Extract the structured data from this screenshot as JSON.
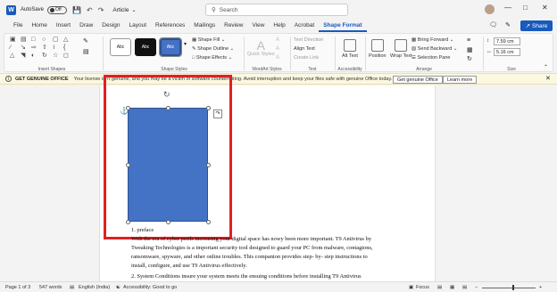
{
  "titlebar": {
    "app_logo": "W",
    "autosave_label": "AutoSave",
    "autosave_state": "Off",
    "doc_title": "Article",
    "search_placeholder": "Search",
    "icons": [
      "word-icon",
      "save-icon",
      "undo-icon",
      "redo-icon",
      "search-icon",
      "avatar",
      "minimize-icon",
      "maximize-icon",
      "close-icon"
    ]
  },
  "tabs": [
    "File",
    "Home",
    "Insert",
    "Draw",
    "Design",
    "Layout",
    "References",
    "Mailings",
    "Review",
    "View",
    "Help",
    "Acrobat",
    "Shape Format"
  ],
  "active_tab": "Shape Format",
  "share_label": "Share",
  "ribbon": {
    "insert_shapes_label": "Insert Shapes",
    "shape_styles": {
      "label": "Shape Styles",
      "swatch_text": "Abc",
      "items": [
        "Shape Fill",
        "Shape Outline",
        "Shape Effects"
      ]
    },
    "wordart": {
      "label": "WordArt Styles",
      "quick_styles": "Quick Styles"
    },
    "text": {
      "label": "Text",
      "items": [
        "Text Direction",
        "Align Text",
        "Create Link"
      ]
    },
    "accessibility": {
      "label": "Accessibility",
      "alt_text": "Alt Text"
    },
    "arrange": {
      "label": "Arrange",
      "position": "Position",
      "wrap_text": "Wrap Text",
      "items": [
        "Bring Forward",
        "Send Backward",
        "Selection Pane"
      ]
    },
    "size": {
      "label": "Size",
      "height": "7.59 cm",
      "width": "5.16 cm"
    }
  },
  "banner": {
    "title": "GET GENUINE OFFICE",
    "message": "Your license isn't genuine, and you may be a victim of software counterfeiting. Avoid interruption and keep your files safe with genuine Office today.",
    "primary_button": "Get genuine Office",
    "secondary_button": "Learn more"
  },
  "document": {
    "shape_color": "#4472c4",
    "highlight_color": "#e02020",
    "line1": "1. preface",
    "para1_line1": "With the era of cyber perils increasing your digital space has nowy been more important. T9 Antivirus by",
    "para1_line2": "Tweaking Technologies is a important security tool designed to guard your PC from malware, contagions,",
    "para1_line3": "ransomware, spyware, and other online troubles. This companion provides step- by- step instructions to",
    "para1_line4": "install, configure, and use T9 Antivirus effectively.",
    "para2_line1": "2. System Conditions insure your system meets the ensuing conditions before installing T9 Antivirus"
  },
  "statusbar": {
    "page": "Page 1 of 3",
    "words": "547 words",
    "language": "English (India)",
    "accessibility": "Accessibility: Good to go",
    "focus": "Focus"
  }
}
